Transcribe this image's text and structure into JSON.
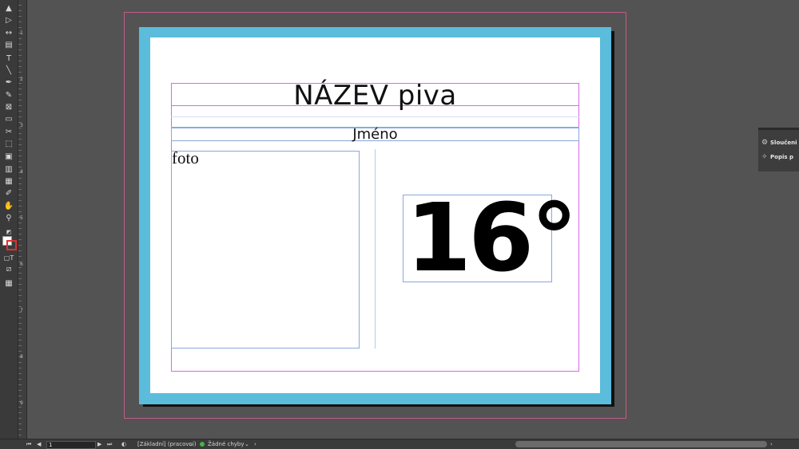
{
  "document": {
    "title_text": "NÁZEV piva",
    "name_text": "Jméno",
    "photo_text": "foto",
    "temperature_text": "16°"
  },
  "toolbar": {
    "tools": [
      {
        "name": "selection-tool-icon",
        "glyph": "▲"
      },
      {
        "name": "direct-selection-tool-icon",
        "glyph": "▷"
      },
      {
        "name": "gap-tool-icon",
        "glyph": "↔"
      },
      {
        "name": "content-collector-icon",
        "glyph": "▤"
      },
      {
        "name": "type-tool-icon",
        "glyph": "T"
      },
      {
        "name": "line-tool-icon",
        "glyph": "╲"
      },
      {
        "name": "pen-tool-icon",
        "glyph": "✒"
      },
      {
        "name": "pencil-tool-icon",
        "glyph": "✎"
      },
      {
        "name": "rectangle-frame-tool-icon",
        "glyph": "⊠"
      },
      {
        "name": "rectangle-tool-icon",
        "glyph": "▭"
      },
      {
        "name": "scissors-tool-icon",
        "glyph": "✂"
      },
      {
        "name": "free-transform-tool-icon",
        "glyph": "⬚"
      },
      {
        "name": "gradient-swatch-tool-icon",
        "glyph": "▣"
      },
      {
        "name": "gradient-feather-tool-icon",
        "glyph": "▥"
      },
      {
        "name": "note-tool-icon",
        "glyph": "▦"
      },
      {
        "name": "eyedropper-tool-icon",
        "glyph": "✐"
      },
      {
        "name": "hand-tool-icon",
        "glyph": "✋"
      },
      {
        "name": "zoom-tool-icon",
        "glyph": "⚲"
      }
    ]
  },
  "ruler": {
    "numbers": [
      "1",
      "2",
      "3",
      "4",
      "5",
      "6",
      "7",
      "8",
      "9"
    ]
  },
  "panels": {
    "items": [
      {
        "label": "Sloučeni",
        "icon": "data-merge-icon"
      },
      {
        "label": "Popis p",
        "icon": "tags-icon"
      }
    ]
  },
  "statusbar": {
    "page_number": "1",
    "preflight_profile": "[Základní] (pracovní)",
    "errors_text": "Žádné chyby",
    "status_color": "#45b545"
  },
  "colors": {
    "page_border": "#5bbcdb",
    "margin_guide": "#d76be0",
    "bleed_guide": "#c05b8b",
    "frame_edge": "#8aa7dd"
  }
}
